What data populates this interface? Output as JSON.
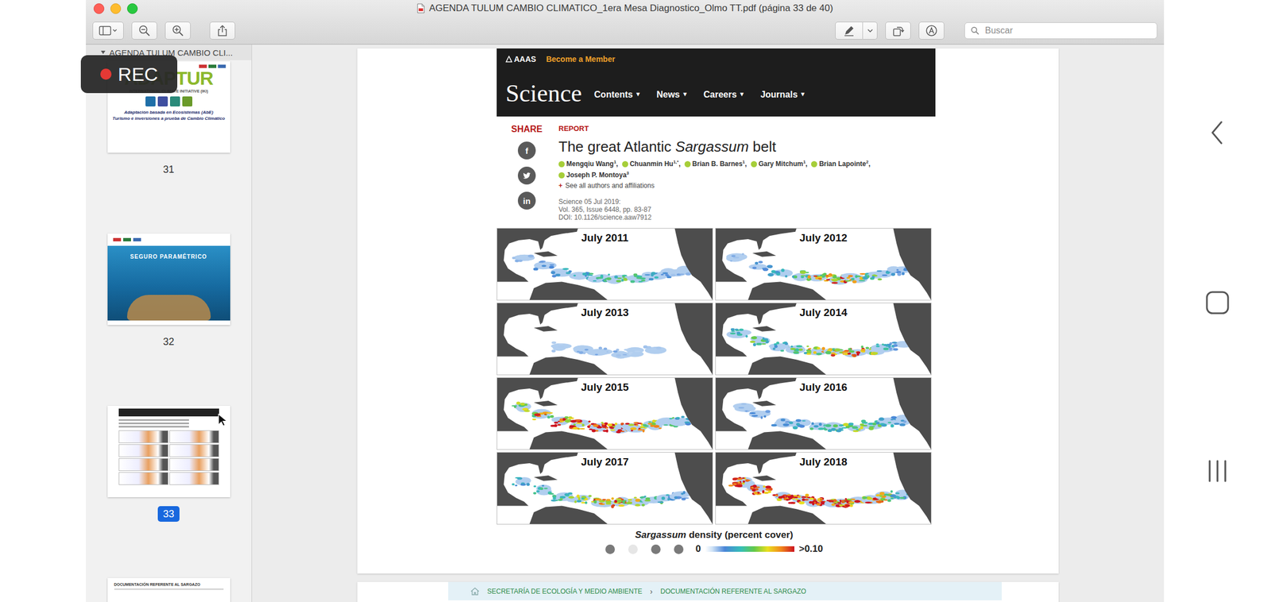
{
  "window": {
    "title": "AGENDA TULUM CAMBIO CLIMATICO_1era Mesa Diagnostico_Olmo TT.pdf (página 33 de 40)"
  },
  "recording": {
    "label": "REC"
  },
  "toolbar": {
    "search": {
      "placeholder": "Buscar"
    }
  },
  "sidebar": {
    "header": "AGENDA TULUM CAMBIO CLI...",
    "pages": [
      {
        "number": "31",
        "selected": false,
        "kind": "cover",
        "title": "ADAPTUR",
        "lines": [
          "INTERNATIONAL CLIMATE INITIATIVE (IKI)",
          "Adaptación basada en Ecosistemas (AbE)",
          "Turismo e inversiones a prueba de Cambio Climático"
        ]
      },
      {
        "number": "32",
        "selected": false,
        "kind": "banner",
        "title": "SEGURO PARAMÉTRICO",
        "lines": []
      },
      {
        "number": "33",
        "selected": true,
        "kind": "mini",
        "title": "",
        "lines": []
      },
      {
        "number": "",
        "selected": false,
        "kind": "doc",
        "title": "DOCUMENTACIÓN REFERENTE AL SARGAZO",
        "lines": []
      }
    ]
  },
  "page": {
    "header": {
      "brand": "AAAS",
      "cta": "Become a Member",
      "logo": "Science",
      "nav": [
        {
          "label": "Contents",
          "caret": "▾"
        },
        {
          "label": "News",
          "caret": "▾"
        },
        {
          "label": "Careers",
          "caret": "▾"
        },
        {
          "label": "Journals",
          "caret": "▾"
        }
      ]
    },
    "share": {
      "label": "SHARE",
      "buttons": [
        {
          "kind": "glyph",
          "glyph": "f"
        },
        {
          "kind": "bird"
        },
        {
          "kind": "glyph",
          "glyph": "in"
        }
      ]
    },
    "article": {
      "type": "REPORT",
      "title": [
        {
          "text": "The great Atlantic ",
          "italic": false
        },
        {
          "text": "Sargassum",
          "italic": true
        },
        {
          "text": " belt",
          "italic": false
        }
      ],
      "authors": [
        {
          "name": "Mengqiu Wang",
          "sup": "1",
          "sep": ","
        },
        {
          "name": "Chuanmin Hu",
          "sup": "1,*",
          "sep": ","
        },
        {
          "name": "Brian B. Barnes",
          "sup": "1",
          "sep": ","
        },
        {
          "name": "Gary Mitchum",
          "sup": "1",
          "sep": ","
        },
        {
          "name": "Brian Lapointe",
          "sup": "2",
          "sep": ","
        },
        {
          "name": "Joseph P. Montoya",
          "sup": "3",
          "sep": ""
        }
      ],
      "more": {
        "icon": "+",
        "label": "See all authors and affiliations"
      },
      "citation": [
        "Science 05 Jul 2019:",
        "Vol. 365, Issue 6448, pp. 83-87",
        "DOI: 10.1126/science.aaw7912"
      ]
    },
    "maps": [
      {
        "title": "July 2011",
        "belt": [
          0.01,
          0.02,
          0.03,
          0.03,
          0.04,
          0.05,
          0.04,
          0.03,
          0.02,
          0.01
        ]
      },
      {
        "title": "July 2012",
        "belt": [
          0.01,
          0.02,
          0.03,
          0.05,
          0.08,
          0.09,
          0.07,
          0.05,
          0.03,
          0.02
        ]
      },
      {
        "title": "July 2013",
        "belt": [
          0,
          0,
          0.005,
          0.01,
          0.01,
          0.01,
          0.005,
          0.005,
          0,
          0
        ]
      },
      {
        "title": "July 2014",
        "belt": [
          0.04,
          0.05,
          0.04,
          0.05,
          0.07,
          0.08,
          0.09,
          0.06,
          0.04,
          0.02
        ]
      },
      {
        "title": "July 2015",
        "belt": [
          0.06,
          0.08,
          0.09,
          0.1,
          0.11,
          0.11,
          0.09,
          0.07,
          0.05,
          0.03
        ]
      },
      {
        "title": "July 2016",
        "belt": [
          0.01,
          0.02,
          0.02,
          0.03,
          0.04,
          0.05,
          0.06,
          0.05,
          0.04,
          0.02
        ]
      },
      {
        "title": "July 2017",
        "belt": [
          0.03,
          0.04,
          0.05,
          0.06,
          0.08,
          0.09,
          0.07,
          0.05,
          0.03,
          0.02
        ]
      },
      {
        "title": "July 2018",
        "belt": [
          0.12,
          0.12,
          0.11,
          0.12,
          0.12,
          0.11,
          0.1,
          0.09,
          0.07,
          0.04
        ]
      }
    ],
    "legend": {
      "title": [
        {
          "text": "Sargassum",
          "italic": true
        },
        {
          "text": " density (percent cover)",
          "italic": false
        }
      ],
      "min": "0",
      "max": ">0.10"
    },
    "carousel": [
      {
        "selected": false
      },
      {
        "selected": true
      },
      {
        "selected": false
      },
      {
        "selected": false
      }
    ]
  },
  "next_page": {
    "breadcrumb": [
      "SECRETARÍA DE ECOLOGÍA Y MEDIO AMBIENTE",
      "DOCUMENTACIÓN REFERENTE AL SARGAZO"
    ],
    "separator": "›"
  }
}
